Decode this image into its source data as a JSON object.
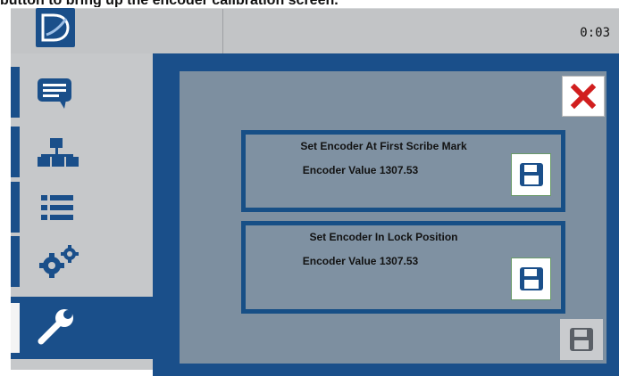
{
  "caption": "button to bring up the encoder calibration screen.",
  "header": {
    "clock": "0:03"
  },
  "sidebar": {
    "items": [
      {
        "icon": "chat-bubble-icon"
      },
      {
        "icon": "network-icon"
      },
      {
        "icon": "list-icon"
      },
      {
        "icon": "gears-icon"
      },
      {
        "icon": "wrench-icon",
        "active": true
      }
    ]
  },
  "cards": [
    {
      "title": "Set Encoder At First Scribe Mark",
      "value": "Encoder Value 1307.53"
    },
    {
      "title": "Set Encoder In Lock Position",
      "value": "Encoder Value 1307.53"
    }
  ],
  "colors": {
    "brand": "#1a4f8a",
    "panel": "#7d8fa0",
    "sidebar": "#c6c8ca",
    "close": "#d11e1e"
  }
}
